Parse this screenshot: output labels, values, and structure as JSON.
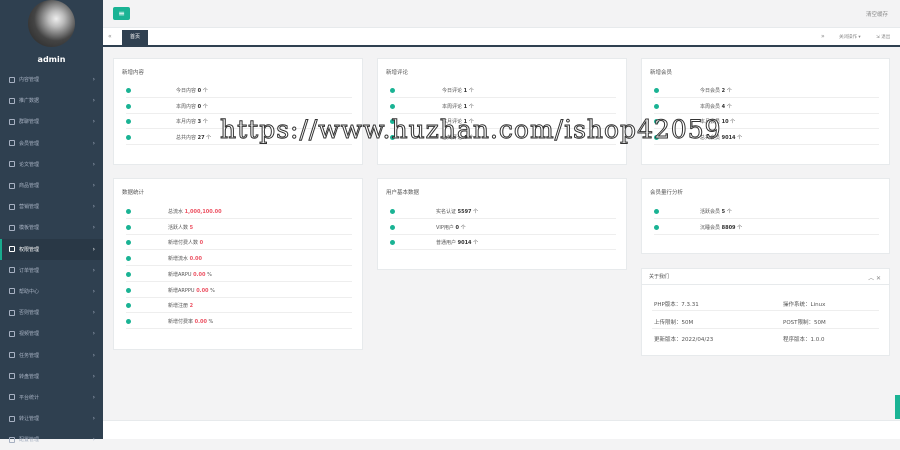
{
  "sidebar": {
    "user": "admin",
    "items": [
      {
        "label": "内容管理",
        "icon": "edit-icon"
      },
      {
        "label": "推广数据",
        "icon": "chart-icon"
      },
      {
        "label": "群聊管理",
        "icon": "group-icon"
      },
      {
        "label": "会员管理",
        "icon": "user-icon"
      },
      {
        "label": "论文管理",
        "icon": "file-icon"
      },
      {
        "label": "商品管理",
        "icon": "cart-icon"
      },
      {
        "label": "营销管理",
        "icon": "gift-icon"
      },
      {
        "label": "模板管理",
        "icon": "layout-icon"
      },
      {
        "label": "权限管理",
        "icon": "lock-icon"
      },
      {
        "label": "订单管理",
        "icon": "list-icon"
      },
      {
        "label": "帮助中心",
        "icon": "help-icon"
      },
      {
        "label": "否则管理",
        "icon": "settings-icon"
      },
      {
        "label": "视频管理",
        "icon": "video-icon"
      },
      {
        "label": "任务管理",
        "icon": "task-icon"
      },
      {
        "label": "转盘管理",
        "icon": "wheel-icon"
      },
      {
        "label": "平台统计",
        "icon": "stats-icon"
      },
      {
        "label": "转让管理",
        "icon": "transfer-icon"
      },
      {
        "label": "配置管理",
        "icon": "config-icon"
      }
    ]
  },
  "topbar": {
    "menu_icon": "≡",
    "clear_cache": "清空缓存"
  },
  "tabbar": {
    "back": "«",
    "home": "首页",
    "forward": "»",
    "ops": "关闭操作 ▾",
    "exit": "⇲ 退出"
  },
  "cards": {
    "content": {
      "title": "新增内容",
      "rows": [
        {
          "label": "今日内容",
          "value": "0",
          "unit": "个"
        },
        {
          "label": "本周内容",
          "value": "0",
          "unit": "个"
        },
        {
          "label": "本月内容",
          "value": "3",
          "unit": "个"
        },
        {
          "label": "总共内容",
          "value": "27",
          "unit": "个"
        }
      ]
    },
    "comments": {
      "title": "新增评论",
      "rows": [
        {
          "label": "今日评论",
          "value": "1",
          "unit": "个"
        },
        {
          "label": "本周评论",
          "value": "1",
          "unit": "个"
        },
        {
          "label": "本月评论",
          "value": "1",
          "unit": "个"
        },
        {
          "label": "总共评论",
          "value": "4",
          "unit": "个"
        }
      ]
    },
    "members": {
      "title": "新增会员",
      "rows": [
        {
          "label": "今日会员",
          "value": "2",
          "unit": "个"
        },
        {
          "label": "本周会员",
          "value": "4",
          "unit": "个"
        },
        {
          "label": "本月会员",
          "value": "10",
          "unit": "个"
        },
        {
          "label": "总共会员",
          "value": "9014",
          "unit": "个"
        }
      ]
    },
    "stats": {
      "title": "数据统计",
      "rows": [
        {
          "label": "总流水",
          "value": "1,000,100.00",
          "unit": ""
        },
        {
          "label": "活跃人数",
          "value": "5",
          "unit": ""
        },
        {
          "label": "新增付费人数",
          "value": "0",
          "unit": ""
        },
        {
          "label": "新增流水",
          "value": "0.00",
          "unit": ""
        },
        {
          "label": "新增ARPU",
          "value": "0.00",
          "unit": "%"
        },
        {
          "label": "新增ARPPU",
          "value": "0.00",
          "unit": "%"
        },
        {
          "label": "新增注册",
          "value": "2",
          "unit": ""
        },
        {
          "label": "新增付费率",
          "value": "0.00",
          "unit": "%"
        }
      ]
    },
    "users": {
      "title": "用户基本数据",
      "rows": [
        {
          "label": "实名认证",
          "value": "5597",
          "unit": "个"
        },
        {
          "label": "VIP用户",
          "value": "0",
          "unit": "个"
        },
        {
          "label": "普通用户",
          "value": "9014",
          "unit": "个"
        }
      ]
    },
    "activity": {
      "title": "会员量行分析",
      "rows": [
        {
          "label": "活跃会员",
          "value": "5",
          "unit": "个"
        },
        {
          "label": "沉睡会员",
          "value": "8809",
          "unit": "个"
        }
      ]
    },
    "about": {
      "title": "关于我们",
      "tools": "︿ ✕",
      "items": [
        {
          "label": "PHP版本：",
          "value": "7.3.31"
        },
        {
          "label": "操作系统：",
          "value": "Linux"
        },
        {
          "label": "上传限制：",
          "value": "50M"
        },
        {
          "label": "POST限制：",
          "value": "50M"
        },
        {
          "label": "更新版本：",
          "value": "2022/04/23"
        },
        {
          "label": "程序版本：",
          "value": "1.0.0"
        }
      ]
    }
  },
  "watermark": "https://www.huzhan.com/ishop42059",
  "colors": {
    "sidebar": "#2f4050",
    "accent": "#1ab394",
    "value_red": "#ed5565"
  }
}
